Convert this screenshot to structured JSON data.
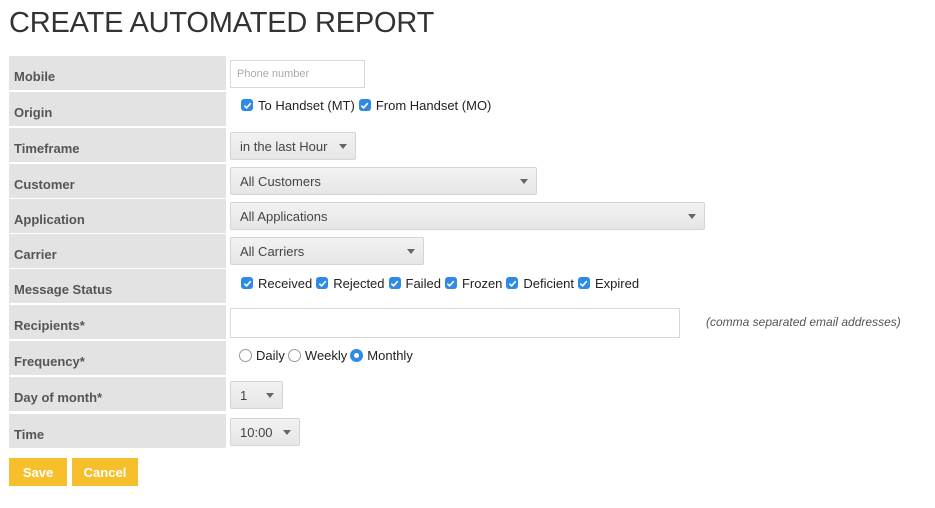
{
  "page": {
    "title": "CREATE AUTOMATED REPORT"
  },
  "form": {
    "mobile": {
      "label": "Mobile",
      "placeholder": "Phone number",
      "value": ""
    },
    "origin": {
      "label": "Origin",
      "options": [
        {
          "label": "To Handset (MT)",
          "checked": true
        },
        {
          "label": "From Handset (MO)",
          "checked": true
        }
      ]
    },
    "timeframe": {
      "label": "Timeframe",
      "value": "in the last Hour"
    },
    "customer": {
      "label": "Customer",
      "value": "All Customers"
    },
    "application": {
      "label": "Application",
      "value": "All Applications"
    },
    "carrier": {
      "label": "Carrier",
      "value": "All Carriers"
    },
    "message_status": {
      "label": "Message Status",
      "options": [
        {
          "label": "Received",
          "checked": true
        },
        {
          "label": "Rejected",
          "checked": true
        },
        {
          "label": "Failed",
          "checked": true
        },
        {
          "label": "Frozen",
          "checked": true
        },
        {
          "label": "Deficient",
          "checked": true
        },
        {
          "label": "Expired",
          "checked": true
        }
      ]
    },
    "recipients": {
      "label": "Recipients*",
      "value": "",
      "hint": "(comma separated email addresses)"
    },
    "frequency": {
      "label": "Frequency*",
      "options": [
        {
          "label": "Daily",
          "selected": false
        },
        {
          "label": "Weekly",
          "selected": false
        },
        {
          "label": "Monthly",
          "selected": true
        }
      ]
    },
    "day_of_month": {
      "label": "Day of month*",
      "value": "1"
    },
    "time": {
      "label": "Time",
      "value": "10:00"
    }
  },
  "actions": {
    "save_label": "Save",
    "cancel_label": "Cancel"
  },
  "colors": {
    "accent_button": "#f7bf2b",
    "checkbox": "#2f8ae5",
    "label_bg": "#e3e3e3"
  }
}
